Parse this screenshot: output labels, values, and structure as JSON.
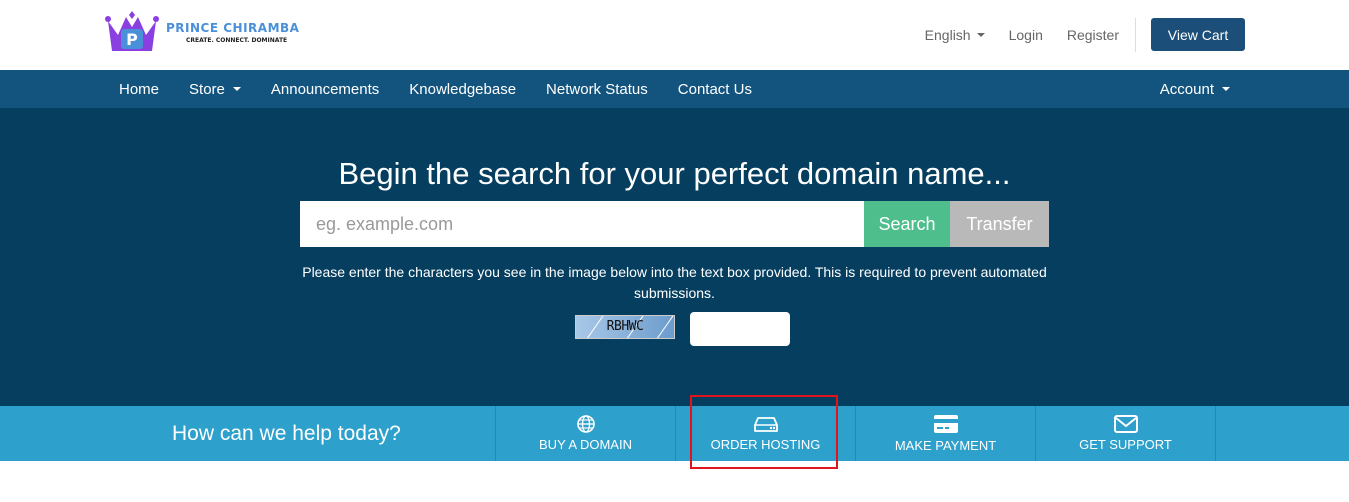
{
  "brand": {
    "name": "PRINCE CHIRAMBA",
    "tagline": "CREATE. CONNECT. DOMINATE",
    "logo_letter": "P",
    "colors": {
      "crown": "#8a3fe0",
      "badge": "#4a90d9"
    }
  },
  "topbar": {
    "language": "English",
    "login": "Login",
    "register": "Register",
    "view_cart": "View Cart"
  },
  "nav": {
    "left": [
      {
        "label": "Home"
      },
      {
        "label": "Store"
      },
      {
        "label": "Announcements"
      },
      {
        "label": "Knowledgebase"
      },
      {
        "label": "Network Status"
      },
      {
        "label": "Contact Us"
      }
    ],
    "account": "Account"
  },
  "hero": {
    "title": "Begin the search for your perfect domain name...",
    "search_placeholder": "eg. example.com",
    "search_button": "Search",
    "transfer_button": "Transfer",
    "captcha_instructions": "Please enter the characters you see in the image below into the text box provided. This is required to prevent automated submissions.",
    "captcha_code": "RBHWC"
  },
  "help": {
    "title": "How can we help today?",
    "items": [
      {
        "label": "BUY A DOMAIN",
        "icon": "globe-icon"
      },
      {
        "label": "ORDER HOSTING",
        "icon": "hdd-icon"
      },
      {
        "label": "MAKE PAYMENT",
        "icon": "credit-card-icon"
      },
      {
        "label": "GET SUPPORT",
        "icon": "envelope-icon"
      }
    ]
  },
  "colors": {
    "nav": "#13547f",
    "hero": "#063e5f",
    "search": "#4fbe8d",
    "transfer": "#b9b9b9",
    "helpbar": "#2da0cc",
    "highlight": "#e0141c"
  }
}
